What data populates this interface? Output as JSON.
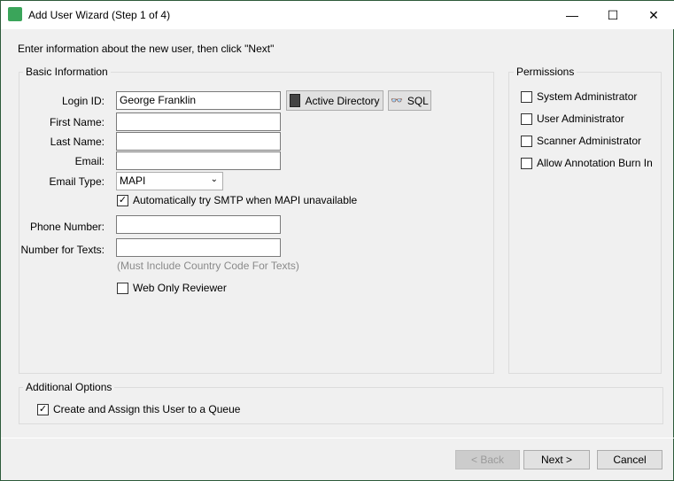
{
  "window": {
    "title": "Add User Wizard (Step 1 of 4)",
    "minimize": "—",
    "maximize": "☐",
    "close": "✕"
  },
  "instructions": "Enter information about the new user, then click \"Next\"",
  "basic": {
    "title": "Basic Information",
    "login_label": "Login ID:",
    "login_value": "George Franklin",
    "active_directory": "Active Directory",
    "sql": "SQL",
    "first_label": "First Name:",
    "first_value": "",
    "last_label": "Last Name:",
    "last_value": "",
    "email_label": "Email:",
    "email_value": "",
    "email_type_label": "Email Type:",
    "email_type_value": "MAPI",
    "smtp_label": "Automatically try SMTP when MAPI unavailable",
    "smtp_checked": true,
    "phone_label": "Phone Number:",
    "phone_value": "",
    "texts_label": "Number for Texts:",
    "texts_value": "",
    "texts_hint": "(Must Include Country Code For Texts)",
    "web_only_label": "Web Only Reviewer",
    "web_only_checked": false
  },
  "permissions": {
    "title": "Permissions",
    "items": [
      {
        "label": "System Administrator",
        "checked": false
      },
      {
        "label": "User Administrator",
        "checked": false
      },
      {
        "label": "Scanner Administrator",
        "checked": false
      },
      {
        "label": "Allow Annotation Burn In",
        "checked": false
      }
    ]
  },
  "additional": {
    "title": "Additional Options",
    "queue_label": "Create and Assign this User to a Queue",
    "queue_checked": true
  },
  "footer": {
    "back": "< Back",
    "next": "Next >",
    "cancel": "Cancel"
  },
  "check_glyph": "✓"
}
